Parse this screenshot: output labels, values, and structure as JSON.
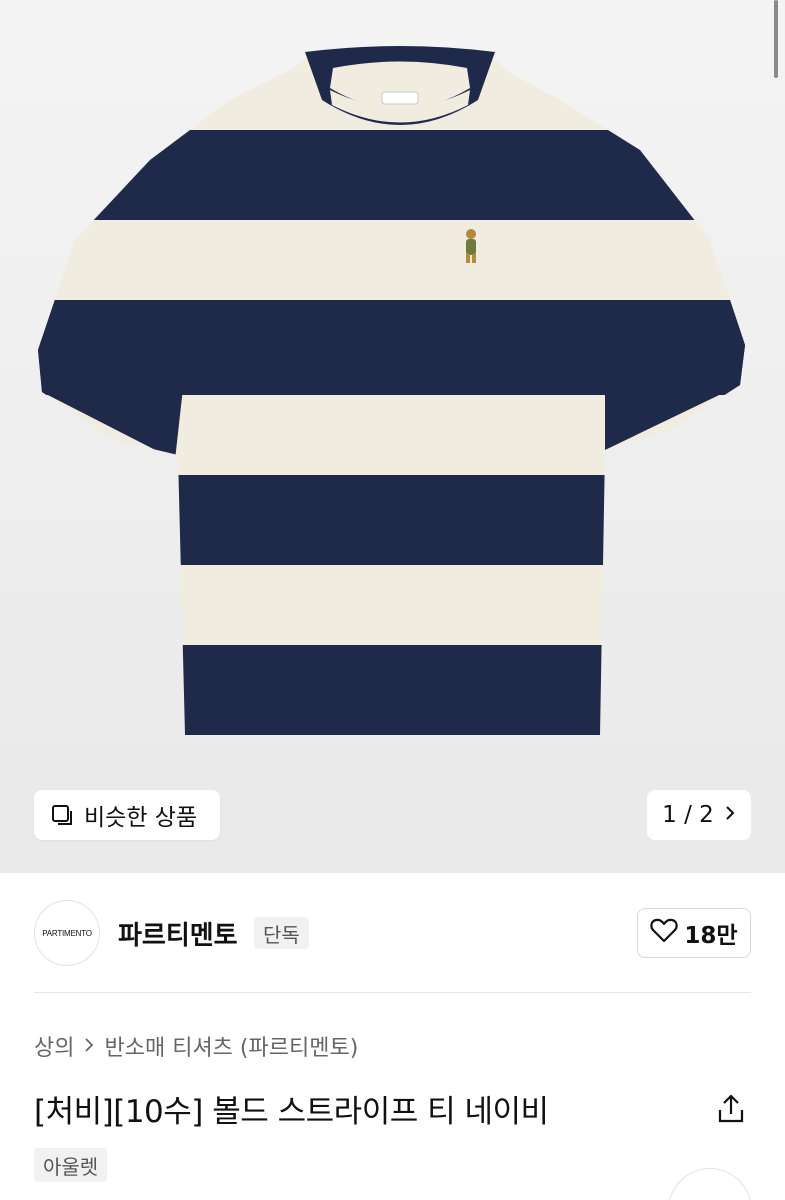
{
  "gallery": {
    "similar_label": "비슷한 상품",
    "page_indicator": "1 / 2",
    "colors": {
      "navy": "#1f2a4a",
      "cream": "#f1ece0"
    }
  },
  "brand": {
    "logo_text": "PARTIMENTO",
    "name": "파르티멘토",
    "badge": "단독",
    "likes": "18만"
  },
  "breadcrumb": {
    "category": "상의",
    "subcategory": "반소매 티셔츠 (파르티멘토)"
  },
  "product": {
    "title": "[처비][10수] 볼드 스트라이프 티 네이비",
    "tag": "아울렛"
  },
  "icons": [
    "similar-items-icon",
    "chevron-right-icon",
    "heart-icon",
    "share-icon"
  ]
}
